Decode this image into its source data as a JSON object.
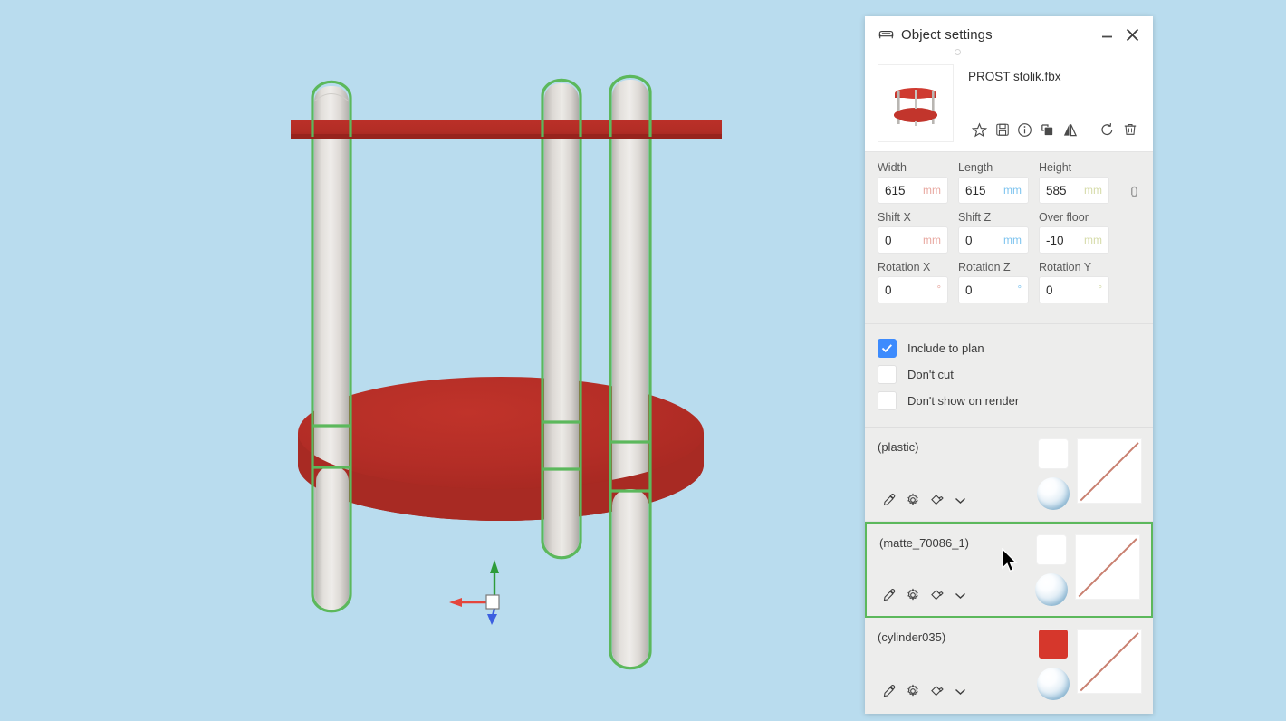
{
  "window": {
    "title": "Object settings",
    "title_icon": "furniture-icon",
    "minimize_label": "–",
    "close_label": "✕"
  },
  "object": {
    "name": "PROST stolik.fbx",
    "thumbnail_alt": "red two-tier side table",
    "toolbar": [
      {
        "name": "favorite-icon",
        "label": "Favorite"
      },
      {
        "name": "save-icon",
        "label": "Save"
      },
      {
        "name": "info-icon",
        "label": "Info"
      },
      {
        "name": "duplicate-icon",
        "label": "Duplicate"
      },
      {
        "name": "mirror-icon",
        "label": "Mirror"
      },
      {
        "name": "reset-icon",
        "label": "Reset"
      },
      {
        "name": "delete-icon",
        "label": "Delete"
      }
    ]
  },
  "dimensions": {
    "lock_icon": "link-icon",
    "rows": [
      [
        {
          "label": "Width",
          "value": "615",
          "unit": "mm",
          "axis": "x"
        },
        {
          "label": "Length",
          "value": "615",
          "unit": "mm",
          "axis": "z"
        },
        {
          "label": "Height",
          "value": "585",
          "unit": "mm",
          "axis": "y"
        }
      ],
      [
        {
          "label": "Shift X",
          "value": "0",
          "unit": "mm",
          "axis": "x"
        },
        {
          "label": "Shift Z",
          "value": "0",
          "unit": "mm",
          "axis": "z"
        },
        {
          "label": "Over floor",
          "value": "-10",
          "unit": "mm",
          "axis": "y"
        }
      ],
      [
        {
          "label": "Rotation X",
          "value": "0",
          "unit": "°",
          "axis": "x"
        },
        {
          "label": "Rotation Z",
          "value": "0",
          "unit": "°",
          "axis": "z"
        },
        {
          "label": "Rotation Y",
          "value": "0",
          "unit": "°",
          "axis": "y"
        }
      ]
    ]
  },
  "options": [
    {
      "label": "Include to plan",
      "checked": true
    },
    {
      "label": "Don't cut",
      "checked": false
    },
    {
      "label": "Don't show on render",
      "checked": false
    }
  ],
  "materials": [
    {
      "name": "(plastic)",
      "selected": false,
      "color": "#ffffff",
      "icons": [
        "eyedropper-icon",
        "gear-icon",
        "paint-icon",
        "chevron-down-icon"
      ]
    },
    {
      "name": "(matte_70086_1)",
      "selected": true,
      "color": "#ffffff",
      "icons": [
        "eyedropper-icon",
        "gear-icon",
        "paint-icon",
        "chevron-down-icon"
      ]
    },
    {
      "name": "(cylinder035)",
      "selected": false,
      "color": "#d6372c",
      "icons": [
        "eyedropper-icon",
        "gear-icon",
        "paint-icon",
        "chevron-down-icon"
      ]
    }
  ],
  "viewport": {
    "background_color": "#b9dcee",
    "table_color": "#b32d26",
    "leg_color": "#d9d6d2",
    "selection_color": "#5cb85c",
    "gizmo": {
      "axis_up_color": "#2e9c3a",
      "axis_left_color": "#e4463c",
      "axis_down_color": "#3b5fe0"
    }
  },
  "colors": {
    "accent_blue": "#3d8bfd",
    "panel_bg": "#ededec",
    "selection_green": "#5cb85c"
  }
}
